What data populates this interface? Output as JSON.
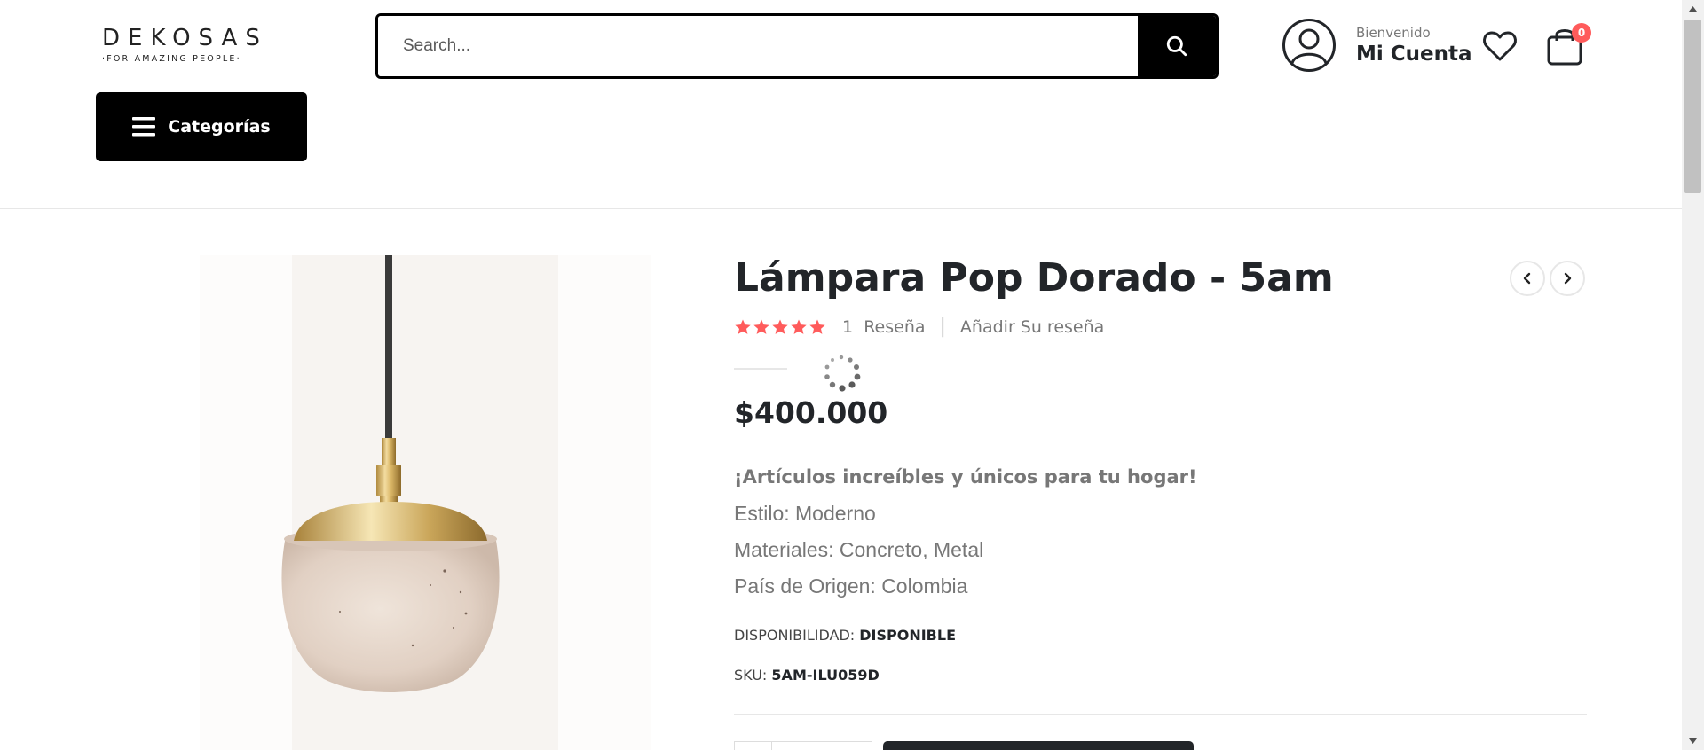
{
  "brand": {
    "name": "DEKOSAS",
    "tagline": "·FOR AMAZING PEOPLE·"
  },
  "search": {
    "placeholder": "Search..."
  },
  "account": {
    "welcome": "Bienvenido",
    "label": "Mi Cuenta"
  },
  "cart": {
    "count": "0"
  },
  "categories": {
    "label": "Categorías"
  },
  "product": {
    "title": "Lámpara Pop Dorado - 5am",
    "rating": 5,
    "review_count": "1",
    "review_label": "Reseña",
    "add_review": "Añadir Su reseña",
    "price": "$400.000",
    "description": {
      "headline": "¡Artículos increíbles y únicos para tu hogar!",
      "style": "Estilo: Moderno",
      "materials": "Materiales: Concreto, Metal",
      "origin": "País de Origen: Colombia"
    },
    "availability_label": "DISPONIBILIDAD:",
    "availability_value": "DISPONIBLE",
    "sku_label": "SKU:",
    "sku_value": "5AM-ILU059D"
  },
  "colors": {
    "accent": "#ff5b5b",
    "dark": "#222529",
    "muted": "#777777"
  },
  "icons": [
    "search-icon",
    "user-icon",
    "heart-icon",
    "bag-icon",
    "menu-icon",
    "star-icon",
    "chevron-left-icon",
    "chevron-right-icon",
    "loading-spinner-icon"
  ]
}
